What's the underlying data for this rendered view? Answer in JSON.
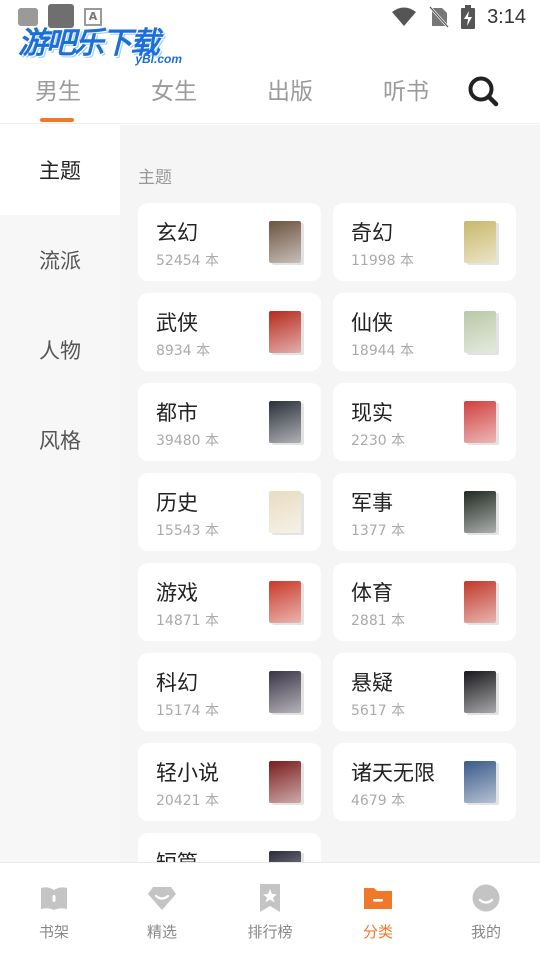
{
  "status_bar": {
    "time": "3:14",
    "notif_letter": "A"
  },
  "logo": {
    "text": "游吧乐下载",
    "sub": "yBl.com"
  },
  "top_tabs": [
    {
      "label": "男生",
      "active": true
    },
    {
      "label": "女生",
      "active": false
    },
    {
      "label": "出版",
      "active": false
    },
    {
      "label": "听书",
      "active": false
    }
  ],
  "sidebar": [
    {
      "label": "主题",
      "active": true
    },
    {
      "label": "流派",
      "active": false
    },
    {
      "label": "人物",
      "active": false
    },
    {
      "label": "风格",
      "active": false
    }
  ],
  "section_title": "主题",
  "categories": [
    {
      "name": "玄幻",
      "count": "52454 本",
      "cover_color": "#6b5340"
    },
    {
      "name": "奇幻",
      "count": "11998 本",
      "cover_color": "#c8b86a"
    },
    {
      "name": "武侠",
      "count": "8934 本",
      "cover_color": "#b52a1e"
    },
    {
      "name": "仙侠",
      "count": "18944 本",
      "cover_color": "#b8c8a8"
    },
    {
      "name": "都市",
      "count": "39480 本",
      "cover_color": "#2a2f3a"
    },
    {
      "name": "现实",
      "count": "2230 本",
      "cover_color": "#d04040"
    },
    {
      "name": "历史",
      "count": "15543 本",
      "cover_color": "#e8dcc0"
    },
    {
      "name": "军事",
      "count": "1377 本",
      "cover_color": "#1f2a22"
    },
    {
      "name": "游戏",
      "count": "14871 本",
      "cover_color": "#c83a2a"
    },
    {
      "name": "体育",
      "count": "2881 本",
      "cover_color": "#c0392b"
    },
    {
      "name": "科幻",
      "count": "15174 本",
      "cover_color": "#3a3446"
    },
    {
      "name": "悬疑",
      "count": "5617 本",
      "cover_color": "#18181c"
    },
    {
      "name": "轻小说",
      "count": "20421 本",
      "cover_color": "#7a1c1c"
    },
    {
      "name": "诸天无限",
      "count": "4679 本",
      "cover_color": "#3a5a8a"
    },
    {
      "name": "短篇",
      "count": "",
      "cover_color": "#2a2a3a"
    }
  ],
  "bottom_nav": [
    {
      "label": "书架",
      "icon": "book-icon",
      "active": false
    },
    {
      "label": "精选",
      "icon": "diamond-icon",
      "active": false
    },
    {
      "label": "排行榜",
      "icon": "ranking-star-icon",
      "active": false
    },
    {
      "label": "分类",
      "icon": "folder-icon",
      "active": true
    },
    {
      "label": "我的",
      "icon": "smile-face-icon",
      "active": false
    }
  ],
  "colors": {
    "accent": "#f0782b",
    "inactive": "#9b9b9b",
    "bg_gray": "#f5f5f5"
  }
}
